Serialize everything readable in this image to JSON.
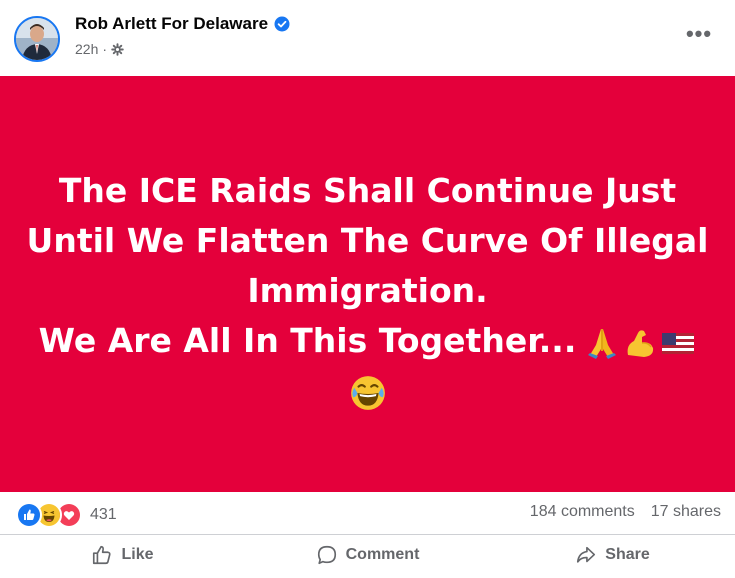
{
  "post": {
    "author": "Rob Arlett For Delaware",
    "time": "22h",
    "separator": "·",
    "more_label": "•••",
    "background_color": "#e4003b",
    "text_lines": [
      "The ICE Raids Shall Continue Just",
      "Until We Flatten The Curve Of Illegal",
      "Immigration.",
      "We Are All In This Together..."
    ],
    "emojis": [
      "folded-hands",
      "flexed-biceps",
      "us-flag",
      "tears-of-joy"
    ]
  },
  "stats": {
    "reaction_count": "431",
    "reaction_types": [
      "like",
      "haha",
      "love"
    ],
    "comments": "184 comments",
    "shares": "17 shares"
  },
  "actions": {
    "like": "Like",
    "comment": "Comment",
    "share": "Share"
  },
  "colors": {
    "accent": "#1877f2",
    "muted_text": "#65676b"
  }
}
